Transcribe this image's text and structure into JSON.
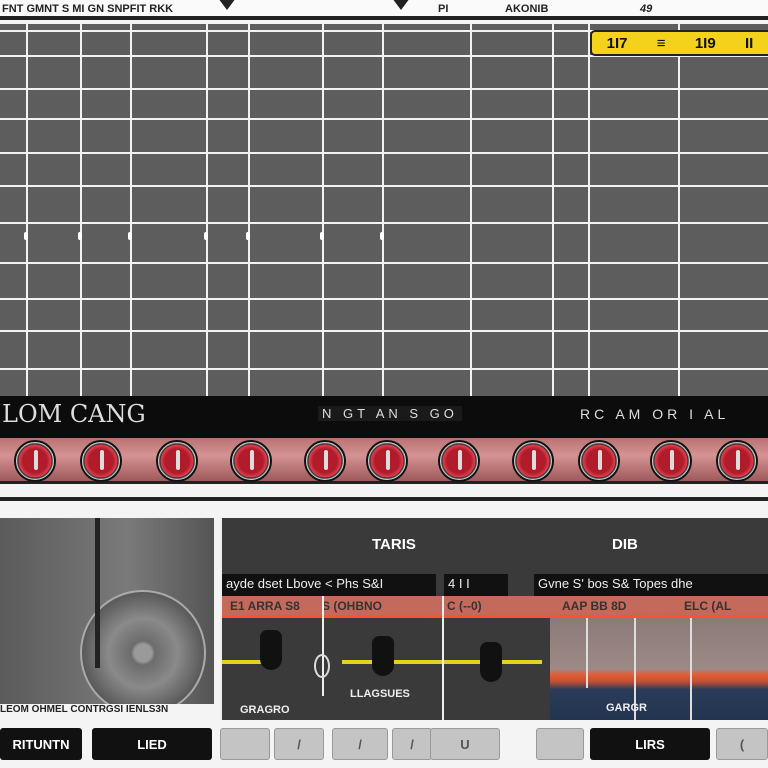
{
  "header": {
    "title": "FNT GMNT S MI GN SNPFIT RKK",
    "label_mid": "PI",
    "label_a": "AKONIB",
    "label_b": "49"
  },
  "yellow_display": {
    "values": [
      "1I7",
      "≡",
      "1I9",
      "II"
    ]
  },
  "label_bar": {
    "left": "LOM CANG",
    "center": "N GT AN S GO",
    "right": "RC AM OR I AL"
  },
  "knobs": {
    "count": 11
  },
  "image_panel": {
    "caption": "LEOM OHMEL CONTRGSI IENLS3N"
  },
  "mixer": {
    "heading_left": "TARIS",
    "heading_right": "DIB",
    "info_left": "ayde dset Lbove < Phs S&I",
    "info_mid": "4 I I",
    "info_right": "Gvne S' bos S& Topes dhe",
    "band_labels": [
      "E1 ARRA S8",
      "S (OHBNO",
      "C (--0)",
      "AAP BB 8D",
      "ELC (AL"
    ],
    "channel_labels": [
      "GRAGRO",
      "LLAGSUES",
      "GARGR"
    ]
  },
  "buttons": [
    {
      "label": "RITUNTN"
    },
    {
      "label": "LIED"
    },
    {
      "label": ""
    },
    {
      "label": "/"
    },
    {
      "label": "/"
    },
    {
      "label": "/"
    },
    {
      "label": "U"
    },
    {
      "label": ""
    },
    {
      "label": "LIRS"
    },
    {
      "label": "("
    }
  ]
}
